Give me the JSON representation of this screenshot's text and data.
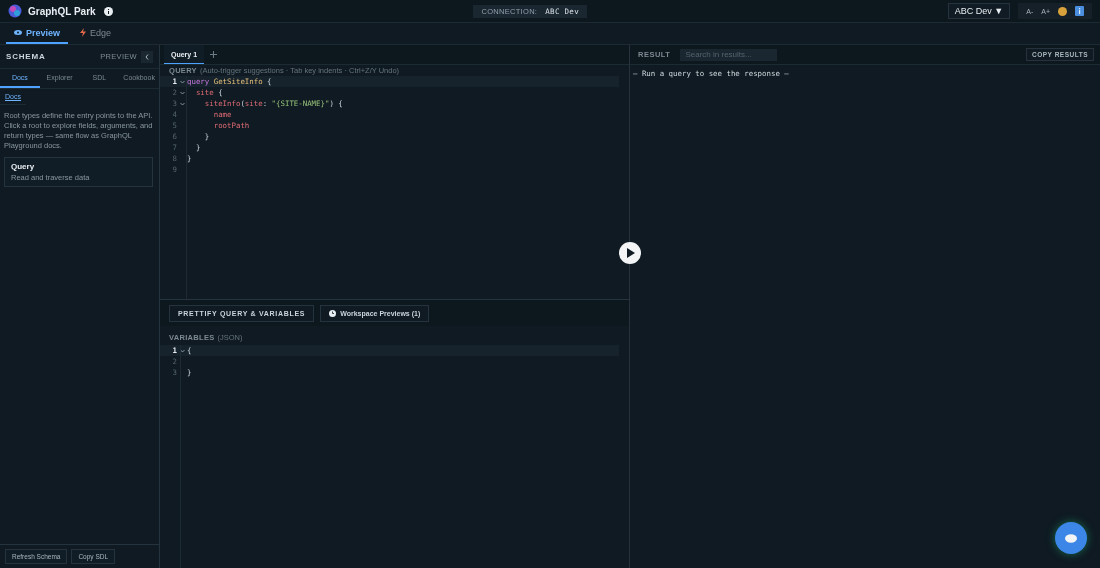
{
  "app": {
    "title": "GraphQL Park"
  },
  "connection": {
    "label": "CONNECTION:",
    "value": "ABC Dev"
  },
  "env_select": {
    "value": "ABC Dev",
    "caret": "▼"
  },
  "font_buttons": [
    "A-",
    "A+"
  ],
  "mode_tabs": [
    {
      "label": "Preview",
      "selected": true,
      "kind": "eye"
    },
    {
      "label": "Edge",
      "selected": false,
      "kind": "bolt"
    }
  ],
  "schema": {
    "title": "SCHEMA",
    "preview_label": "PREVIEW",
    "tabs": [
      {
        "label": "Docs",
        "selected": true
      },
      {
        "label": "Explorer",
        "selected": false
      },
      {
        "label": "SDL",
        "selected": false
      },
      {
        "label": "Cookbook",
        "selected": false
      }
    ],
    "breadcrumb": "Docs",
    "description": "Root types define the entry points to the API. Click a root to explore fields, arguments, and return types — same flow as GraphQL Playground docs.",
    "roots": [
      {
        "name": "Query",
        "description": "Read and traverse data"
      }
    ],
    "buttons": [
      "Refresh Schema",
      "Copy SDL"
    ]
  },
  "query_tabs": [
    {
      "label": "Query 1",
      "selected": true
    }
  ],
  "query_editor": {
    "label": "QUERY",
    "hint": "(Auto-trigger suggestions · Tab key indents · Ctrl+Z/Y Undo)",
    "lines": [
      {
        "number": "1",
        "current": true,
        "foldable": true,
        "tokens": [
          {
            "kind": "keyword",
            "text": "query"
          },
          {
            "kind": "name",
            "text": " GetSiteInfo"
          },
          {
            "kind": "punct",
            "text": " {"
          }
        ]
      },
      {
        "number": "2",
        "current": false,
        "foldable": true,
        "tokens": [
          {
            "kind": "field",
            "text": "  site"
          },
          {
            "kind": "punct",
            "text": " {"
          }
        ]
      },
      {
        "number": "3",
        "current": false,
        "foldable": true,
        "tokens": [
          {
            "kind": "field",
            "text": "    siteInfo"
          },
          {
            "kind": "punct",
            "text": "("
          },
          {
            "kind": "field",
            "text": "site"
          },
          {
            "kind": "punct",
            "text": ": "
          },
          {
            "kind": "string",
            "text": "\"{SITE-NAME}\""
          },
          {
            "kind": "punct",
            "text": ") {"
          }
        ]
      },
      {
        "number": "4",
        "current": false,
        "foldable": false,
        "tokens": [
          {
            "kind": "field",
            "text": "      name"
          }
        ]
      },
      {
        "number": "5",
        "current": false,
        "foldable": false,
        "tokens": [
          {
            "kind": "field",
            "text": "      rootPath"
          }
        ]
      },
      {
        "number": "6",
        "current": false,
        "foldable": false,
        "tokens": [
          {
            "kind": "punct",
            "text": "    }"
          }
        ]
      },
      {
        "number": "7",
        "current": false,
        "foldable": false,
        "tokens": [
          {
            "kind": "punct",
            "text": "  }"
          }
        ]
      },
      {
        "number": "8",
        "current": false,
        "foldable": false,
        "tokens": [
          {
            "kind": "punct",
            "text": "}"
          }
        ]
      },
      {
        "number": "9",
        "current": false,
        "foldable": false
      }
    ]
  },
  "actions": [
    {
      "label": "PRETTIFY QUERY & VARIABLES",
      "kind": "plain"
    },
    {
      "label": "Workspace Previews (1)",
      "kind": "clock"
    }
  ],
  "variables_editor": {
    "label": "VARIABLES",
    "hint": "(JSON)",
    "lines": [
      {
        "number": "1",
        "current": true,
        "foldable": true,
        "tokens": [
          {
            "kind": "punct",
            "text": "{"
          }
        ]
      },
      {
        "number": "2",
        "current": false,
        "foldable": false
      },
      {
        "number": "3",
        "current": false,
        "foldable": false,
        "tokens": [
          {
            "kind": "punct",
            "text": "}"
          }
        ]
      }
    ]
  },
  "result": {
    "label": "RESULT",
    "search_placeholder": "Search in results...",
    "copy_button": "COPY RESULTS",
    "message": "— Run a query to see the response —"
  }
}
